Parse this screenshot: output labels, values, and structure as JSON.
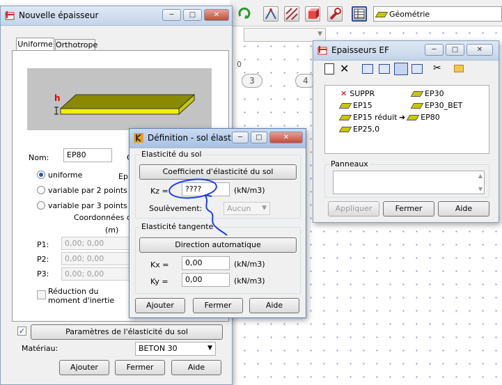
{
  "toolbar": {
    "geometry_combo": "Géométrie"
  },
  "axis_bubbles": [
    "3",
    "4"
  ],
  "axis_marker": "0",
  "nouvelle": {
    "title": "Nouvelle épaisseur",
    "tab_uniforme": "Uniforme",
    "tab_orthotrope": "Orthotrope",
    "h_label": "h",
    "nom_label": "Nom:",
    "nom_value": "EP80",
    "ep_label": "Ep",
    "c_label": "C",
    "radio_uniforme": "uniforme",
    "radio_var2": "variable par 2 points",
    "radio_var3": "variable par 3 points",
    "coords_label": "Coordonnées du",
    "m_label": "(m)",
    "p1_label": "P1:",
    "p1_value": "0,00; 0,00",
    "p2_label": "P2:",
    "p2_value": "0,00; 0,00",
    "p3_label": "P3:",
    "p3_value": "0,00; 0,00",
    "reduction_label": "Réduction du moment d'inertie",
    "params_btn": "Paramètres de l'élasticité du sol",
    "materiau_label": "Matériau:",
    "materiau_value": "BETON 30",
    "ajouter": "Ajouter",
    "fermer": "Fermer",
    "aide": "Aide"
  },
  "definition": {
    "title": "Définition - sol élasti...",
    "grp1": "Elasticité du sol",
    "coef_btn": "Coefficient d'élasticité du sol",
    "kz_label": "Kz =",
    "kz_value": "????",
    "kz_unit": "(kN/m3)",
    "soul_label": "Soulèvement:",
    "soul_value": "Aucun",
    "grp2": "Elasticité tangente",
    "dir_btn": "Direction automatique",
    "kx_label": "Kx =",
    "kx_value": "0,00",
    "kx_unit": "(kN/m3)",
    "ky_label": "Ky =",
    "ky_value": "0,00",
    "ky_unit": "(kN/m3)",
    "ajouter": "Ajouter",
    "fermer": "Fermer",
    "aide": "Aide"
  },
  "epaisseurs": {
    "title": "Epaisseurs EF",
    "items_col1": [
      "SUPPR",
      "EP15",
      "EP15  réduit",
      "EP25,0"
    ],
    "items_col2": [
      "EP30",
      "EP30_BET",
      "EP80"
    ],
    "panneaux": "Panneaux",
    "appliquer": "Appliquer",
    "fermer": "Fermer",
    "aide": "Aide"
  }
}
